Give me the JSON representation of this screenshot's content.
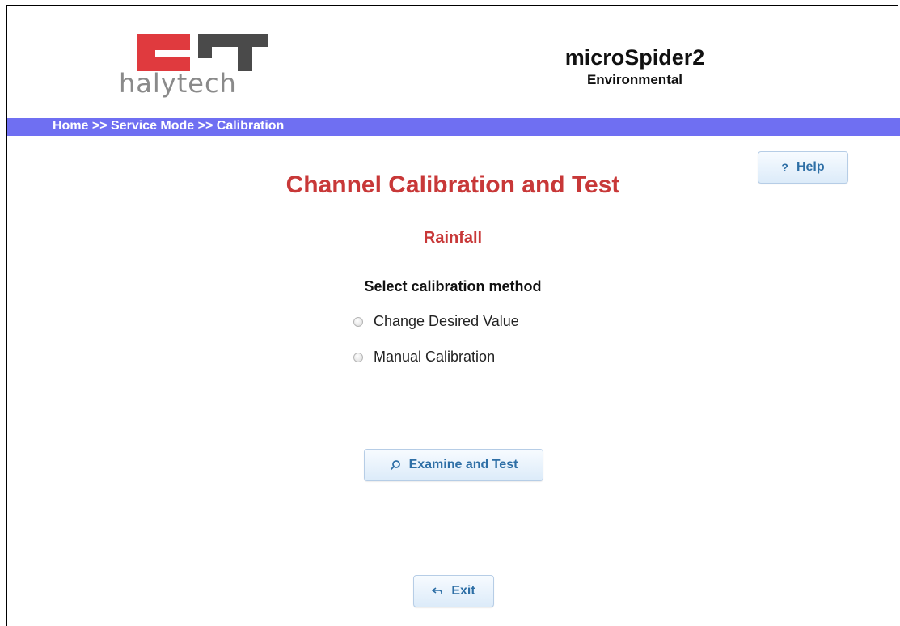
{
  "header": {
    "logo_text": "halytech",
    "product_name": "microSpider2",
    "product_subtitle": "Environmental"
  },
  "breadcrumb": "Home >> Service Mode >> Calibration",
  "help_button": {
    "label": "Help",
    "icon": "question-icon"
  },
  "page": {
    "title": "Channel Calibration and Test",
    "channel": "Rainfall",
    "method_heading": "Select calibration method",
    "options": [
      {
        "label": "Change Desired Value",
        "selected": false
      },
      {
        "label": "Manual Calibration",
        "selected": false
      }
    ]
  },
  "examine_button": {
    "label": "Examine and Test",
    "icon": "search-icon"
  },
  "exit_button": {
    "label": "Exit",
    "icon": "back-arrow-icon"
  },
  "colors": {
    "accent_red": "#c83838",
    "nav_bar": "#6f6ff2",
    "button_text": "#2e6fa6"
  }
}
